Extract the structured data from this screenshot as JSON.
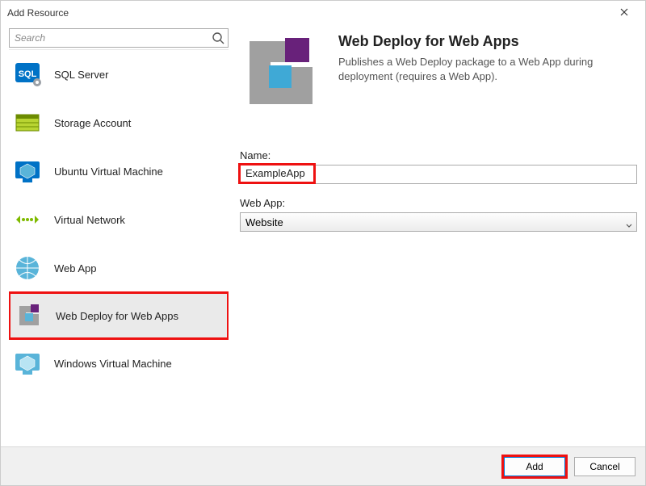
{
  "window": {
    "title": "Add Resource"
  },
  "search": {
    "placeholder": "Search"
  },
  "resources": {
    "items": [
      {
        "label": "SQL Server",
        "icon": "sql-server-icon"
      },
      {
        "label": "Storage Account",
        "icon": "storage-icon"
      },
      {
        "label": "Ubuntu Virtual Machine",
        "icon": "ubuntu-vm-icon"
      },
      {
        "label": "Virtual Network",
        "icon": "virtual-network-icon"
      },
      {
        "label": "Web App",
        "icon": "web-app-icon"
      },
      {
        "label": "Web Deploy for Web Apps",
        "icon": "web-deploy-icon",
        "selected": true
      },
      {
        "label": "Windows Virtual Machine",
        "icon": "windows-vm-icon"
      }
    ]
  },
  "detail": {
    "title": "Web Deploy for Web Apps",
    "description": "Publishes a Web Deploy package to a Web App during deployment (requires a Web App).",
    "name_label": "Name:",
    "name_value": "ExampleApp",
    "webapp_label": "Web App:",
    "webapp_value": "Website"
  },
  "footer": {
    "add_label": "Add",
    "cancel_label": "Cancel"
  }
}
